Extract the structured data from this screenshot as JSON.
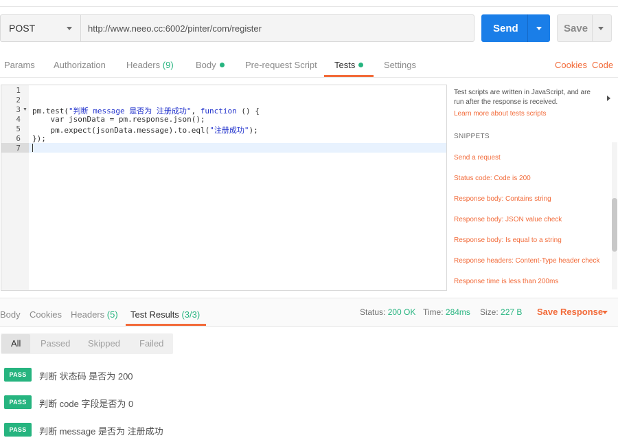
{
  "request": {
    "method": "POST",
    "url": "http://www.neeo.cc:6002/pinter/com/register",
    "send_label": "Send",
    "save_label": "Save"
  },
  "request_tabs": {
    "params": "Params",
    "authorization": "Authorization",
    "headers": "Headers",
    "headers_count": "(9)",
    "body": "Body",
    "prerequest": "Pre-request Script",
    "tests": "Tests",
    "settings": "Settings",
    "cookies": "Cookies",
    "code": "Code"
  },
  "editor": {
    "line_numbers": [
      "1",
      "2",
      "3",
      "4",
      "5",
      "6",
      "7"
    ],
    "lines": [
      "",
      "",
      "pm.test(\"判断 message 是否为 注册成功\", function () {",
      "    var jsonData = pm.response.json();",
      "    pm.expect(jsonData.message).to.eql(\"注册成功\");",
      "});",
      ""
    ],
    "line3": {
      "pre": "pm.test(",
      "str": "\"判断 message 是否为 注册成功\"",
      "mid": ", ",
      "kw": "function",
      "post": " () {"
    },
    "line5": {
      "pre": "    pm.expect(jsonData.message).to.eql(",
      "str": "\"注册成功\"",
      "post": ");"
    }
  },
  "snippets": {
    "description": "Test scripts are written in JavaScript, and are run after the response is received.",
    "learn_more": "Learn more about tests scripts",
    "title": "SNIPPETS",
    "items": [
      "Send a request",
      "Status code: Code is 200",
      "Response body: Contains string",
      "Response body: JSON value check",
      "Response body: Is equal to a string",
      "Response headers: Content-Type header check",
      "Response time is less than 200ms"
    ]
  },
  "response_tabs": {
    "body": "Body",
    "cookies": "Cookies",
    "headers": "Headers",
    "headers_count": "(5)",
    "test_results": "Test Results",
    "test_results_count": "(3/3)"
  },
  "response_meta": {
    "status_label": "Status:",
    "status_value": "200 OK",
    "time_label": "Time:",
    "time_value": "284ms",
    "size_label": "Size:",
    "size_value": "227 B",
    "save_response": "Save Response"
  },
  "filters": [
    "All",
    "Passed",
    "Skipped",
    "Failed"
  ],
  "results": [
    {
      "badge": "PASS",
      "text": "判断 状态码 是否为 200"
    },
    {
      "badge": "PASS",
      "text": "判断 code 字段是否为 0"
    },
    {
      "badge": "PASS",
      "text": "判断 message 是否为 注册成功"
    }
  ],
  "colors": {
    "accent": "#f26b3a",
    "primary": "#1a7ee8",
    "success": "#26b47f"
  }
}
